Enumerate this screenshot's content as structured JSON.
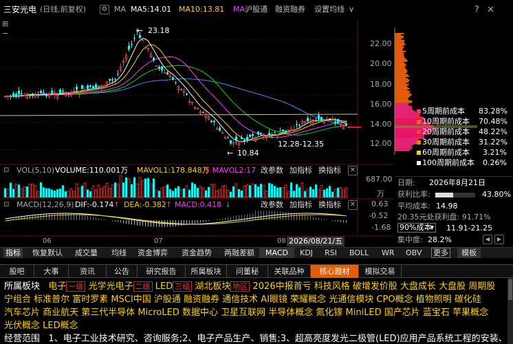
{
  "header": {
    "stock": "三安光电",
    "mode": "(日线,前复权)",
    "indicator": "MA",
    "ma5": "MA5:14.01",
    "ma10": "MA10:13.81",
    "ma20_prefix": "MA",
    "tabs": [
      "沪股通",
      "融资融券",
      "设置均线"
    ],
    "colors": {
      "ma5": "#ffffff",
      "ma10": "#ffd200",
      "ma20": "#ff3cff",
      "ma30": "#00e000",
      "ma60": "#3c8cff"
    }
  },
  "price_chart": {
    "high_label": "23.18",
    "low_label": "10.84",
    "range_label": "12.28-12.35",
    "right_axis": [
      "22.00",
      "20.00",
      "18.00",
      "16.00",
      "14.00",
      "12.00"
    ]
  },
  "cost_legend": [
    {
      "label": "5周期前成本",
      "value": "83.28%",
      "color": "#ff3c3c"
    },
    {
      "label": "10周期前成本",
      "value": "70.48%",
      "color": "#ff6e00"
    },
    {
      "label": "20周期前成本",
      "value": "48.22%",
      "color": "#ff3c3c"
    },
    {
      "label": "30周期前成本",
      "value": "31.22%",
      "color": "#ff7800"
    },
    {
      "label": "60周期前成本",
      "value": "3.21%",
      "color": "#ffd200"
    },
    {
      "label": "100周期前成本",
      "value": "0.26%",
      "color": "#ffffff"
    }
  ],
  "volume_panel": {
    "title": "VOL(5,10)",
    "vol": "VOLUME:110.001万",
    "mavol1": "MAVOL1:178.848万",
    "mavol2": "MAVOL2:17",
    "arrow1": "↑",
    "arrow2": "↓",
    "buttons": [
      "改参数",
      "加指标",
      "换指标"
    ],
    "axis_top": "687.00",
    "axis_unit": "万"
  },
  "macd_panel": {
    "title": "MACD(12,26,9)",
    "dif": "DIF:-0.174",
    "dea": "DEA:-0.382",
    "macd": "MACD:0.418",
    "arrow1": "↑",
    "arrow2": "↑",
    "arrow3": "↓",
    "buttons": [
      "改参数",
      "加指标",
      "换指标"
    ],
    "axis": [
      "0.63",
      "-0.52",
      "-1.68"
    ]
  },
  "x_axis": {
    "labels": [
      "06",
      "07",
      "08"
    ],
    "cursor_date": "2026/08/21/五"
  },
  "info_panel": {
    "date_label": "日期:",
    "date_value": "2026年8月21日",
    "profit_label": "获利比率:",
    "profit_value": "43.80%",
    "avg_label": "平均成本:",
    "avg_value": "14.98",
    "conc_text": "20.35元处获利盘: 91.71%",
    "cost_select": "90%成本",
    "cost_range": "11.91-21.25",
    "conc_label": "集中度:",
    "conc_value": "28.2%",
    "buttons": [
      "◀",
      "▶"
    ]
  },
  "bottom_tabs": [
    "指标",
    "恢复默认",
    "成交量",
    "均线",
    "资金博弈",
    "资金趋势",
    "两融差额",
    "MACD",
    "KDJ",
    "RSI",
    "BOLL",
    "WR",
    "OBV",
    "更多",
    "模板"
  ],
  "function_tabs": [
    "股吧",
    "大事",
    "资讯",
    "公告",
    "研究报告",
    "所属板块",
    "问董秘",
    "关联品种",
    "核心题材",
    "模拟交易"
  ],
  "active_function_tab": "核心题材",
  "sector": {
    "label": "所属板块",
    "items": [
      {
        "text": "电子",
        "tag": "一级"
      },
      {
        "text": "光学光电子",
        "tag": "二级"
      },
      {
        "text": "LED",
        "tag": "三级"
      },
      {
        "text": "湖北板块",
        "tag": "地区"
      }
    ],
    "line1_rest": "2026中报首亏 科技风格 破增发价股 大盘成长 大盘股 周期股",
    "line2": "宁组合 标准普尔 富时罗素 MSCI中国 沪股通 融资融券 通信技术 AI眼镜 荣耀概念 光通信模块 CPO概念 植物照明 碳化硅",
    "line3": "汽车芯片 商业航天 第三代半导体 MicroLED 数据中心 卫星互联网 半导体概念 氮化镓 MiniLED 国产芯片 蓝宝石 苹果概念",
    "line4": "光伏概念 LED概念"
  },
  "business": {
    "label": "经营范围",
    "text": "1、电子工业技术研究、咨询服务;2、电子产品生产、销售;3、超高亮度发光二极管(LED)应用产品系统工程的安装、"
  }
}
